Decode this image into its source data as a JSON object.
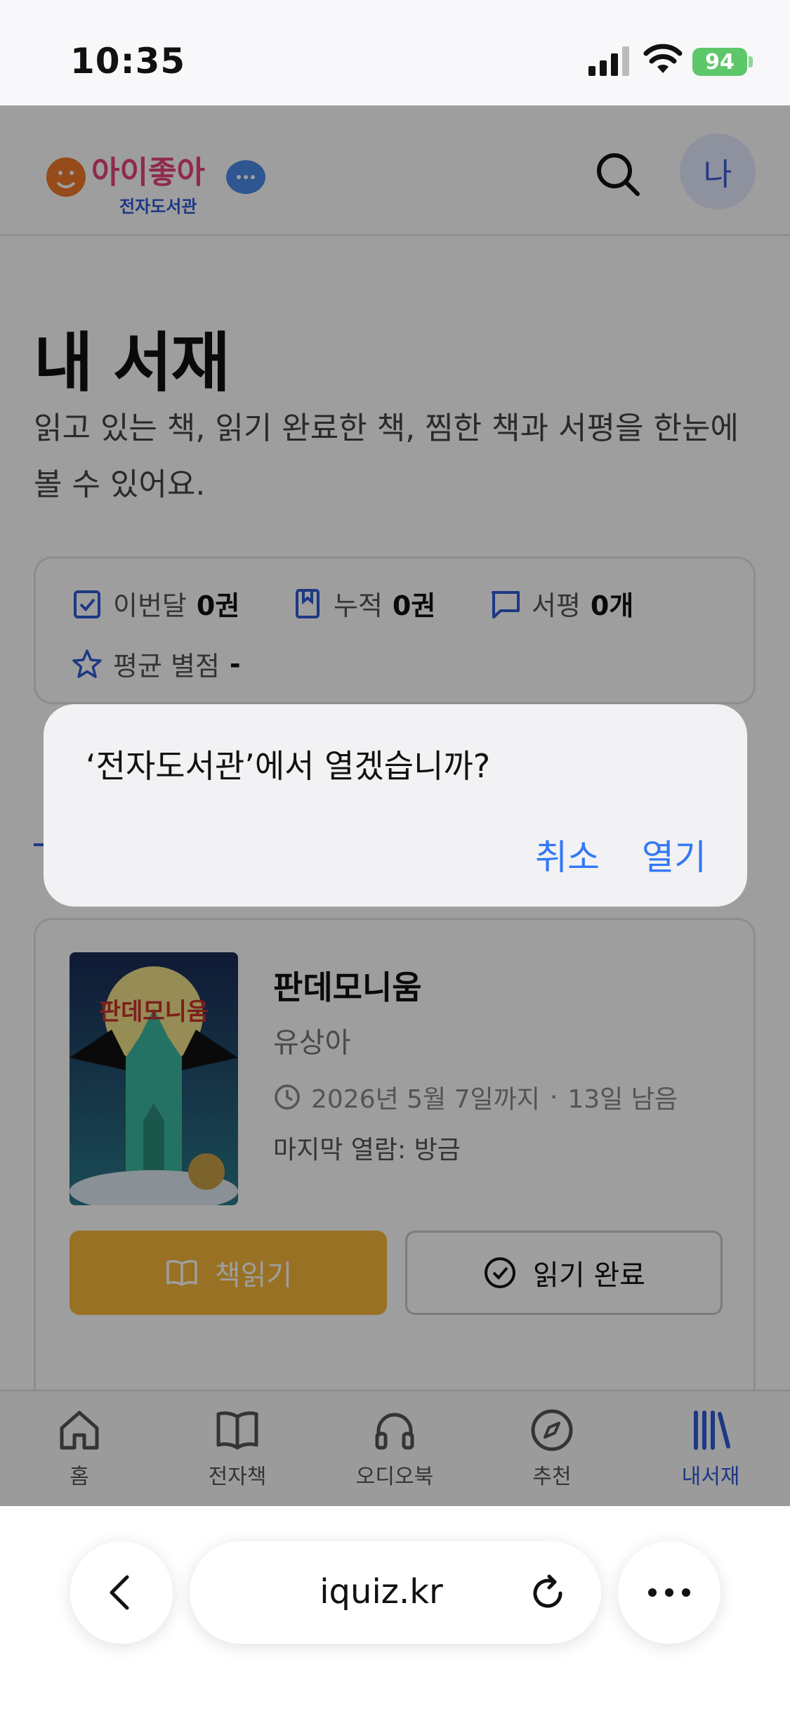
{
  "status_bar": {
    "time": "10:35",
    "battery": "94"
  },
  "header": {
    "logo_text": "아이좋아",
    "logo_sub": "전자도서관",
    "avatar": "나"
  },
  "page": {
    "title": "내 서재",
    "description": "읽고 있는 책, 읽기 완료한 책, 찜한 책과 서평을 한눈에 볼 수 있어요."
  },
  "stats": {
    "month_label": "이번달",
    "month_value": "0권",
    "total_label": "누적",
    "total_value": "0권",
    "review_label": "서평",
    "review_value": "0개",
    "rating_label": "평균 별점",
    "rating_value": "-"
  },
  "book": {
    "cover_title": "판데모니움",
    "title": "판데모니움",
    "author": "유상아",
    "due": "2026년 5월 7일까지",
    "remaining": "13일 남음",
    "last_opened": "마지막 열람: 방금",
    "read_button": "책읽기",
    "done_button": "읽기 완료"
  },
  "nav": {
    "items": [
      {
        "label": "홈",
        "icon": "home-icon"
      },
      {
        "label": "전자책",
        "icon": "book-icon"
      },
      {
        "label": "오디오북",
        "icon": "headphones-icon"
      },
      {
        "label": "추천",
        "icon": "compass-icon"
      },
      {
        "label": "내서재",
        "icon": "library-icon"
      }
    ],
    "active": "내서재"
  },
  "dialog": {
    "message": "‘전자도서관’에서 열겠습니까?",
    "cancel": "취소",
    "open": "열기"
  },
  "browser": {
    "url": "iquiz.kr"
  },
  "colors": {
    "accent": "#2f5bd6",
    "read_button": "#f5b63a",
    "ios_blue": "#3478f6",
    "battery": "#5ec76a"
  }
}
